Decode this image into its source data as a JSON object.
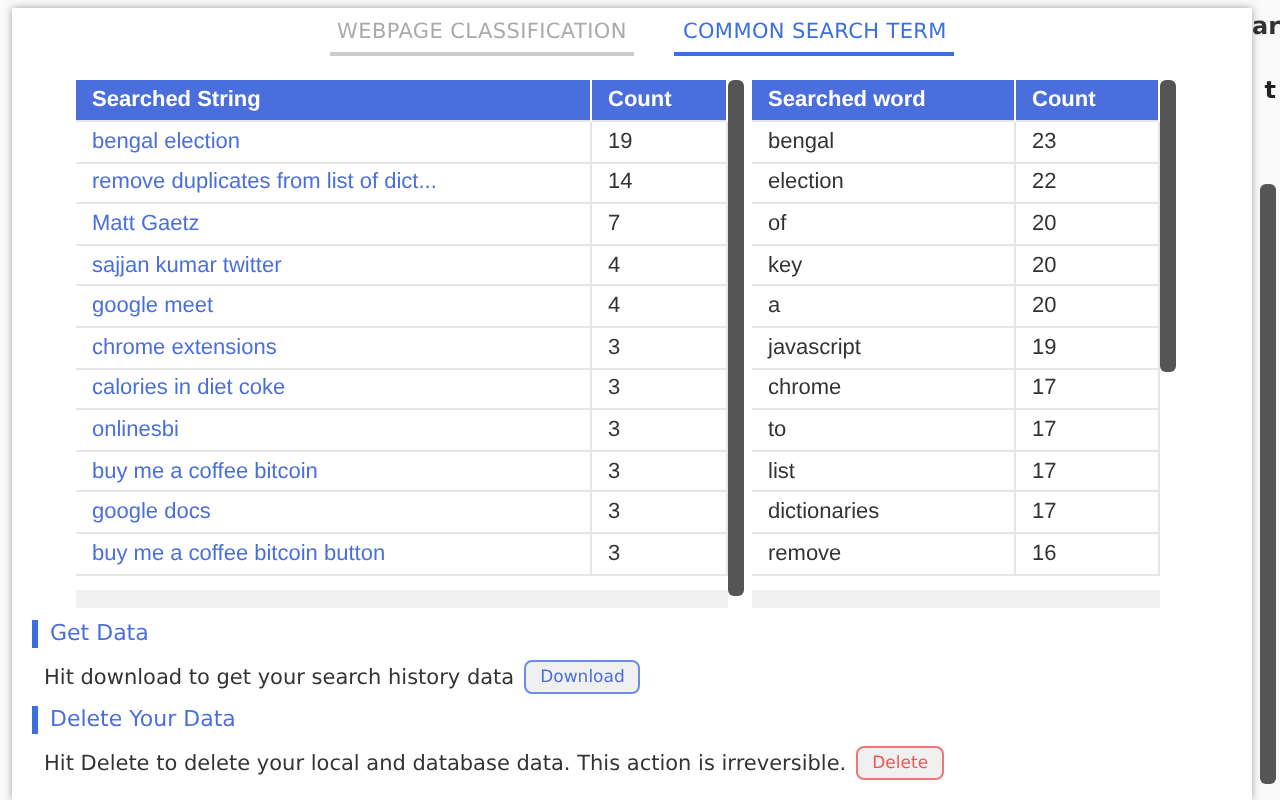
{
  "background": {
    "texts": [
      "ar",
      "t"
    ]
  },
  "tabs": [
    {
      "label": "WEBPAGE CLASSIFICATION",
      "selected": false
    },
    {
      "label": "COMMON SEARCH TERM",
      "selected": true
    }
  ],
  "tables": [
    {
      "columns": [
        "Searched String",
        "Count"
      ],
      "link_first_column": true,
      "rows": [
        [
          "bengal election",
          "19"
        ],
        [
          "remove duplicates from list of dict...",
          "14"
        ],
        [
          "Matt Gaetz",
          "7"
        ],
        [
          "sajjan kumar twitter",
          "4"
        ],
        [
          "google meet",
          "4"
        ],
        [
          "chrome extensions",
          "3"
        ],
        [
          "calories in diet coke",
          "3"
        ],
        [
          "onlinesbi",
          "3"
        ],
        [
          "buy me a coffee bitcoin",
          "3"
        ],
        [
          "google docs",
          "3"
        ],
        [
          "buy me a coffee bitcoin button",
          "3"
        ]
      ]
    },
    {
      "columns": [
        "Searched word",
        "Count"
      ],
      "link_first_column": false,
      "rows": [
        [
          "bengal",
          "23"
        ],
        [
          "election",
          "22"
        ],
        [
          "of",
          "20"
        ],
        [
          "key",
          "20"
        ],
        [
          "a",
          "20"
        ],
        [
          "javascript",
          "19"
        ],
        [
          "chrome",
          "17"
        ],
        [
          "to",
          "17"
        ],
        [
          "list",
          "17"
        ],
        [
          "dictionaries",
          "17"
        ],
        [
          "remove",
          "16"
        ]
      ]
    }
  ],
  "sections": [
    {
      "title": "Get Data",
      "text": "Hit download to get your search history data",
      "button": {
        "label": "Download",
        "kind": "primary"
      }
    },
    {
      "title": "Delete Your Data",
      "text": "Hit Delete to delete your local and database data. This action is irreversible.",
      "button": {
        "label": "Delete",
        "kind": "danger"
      }
    }
  ]
}
